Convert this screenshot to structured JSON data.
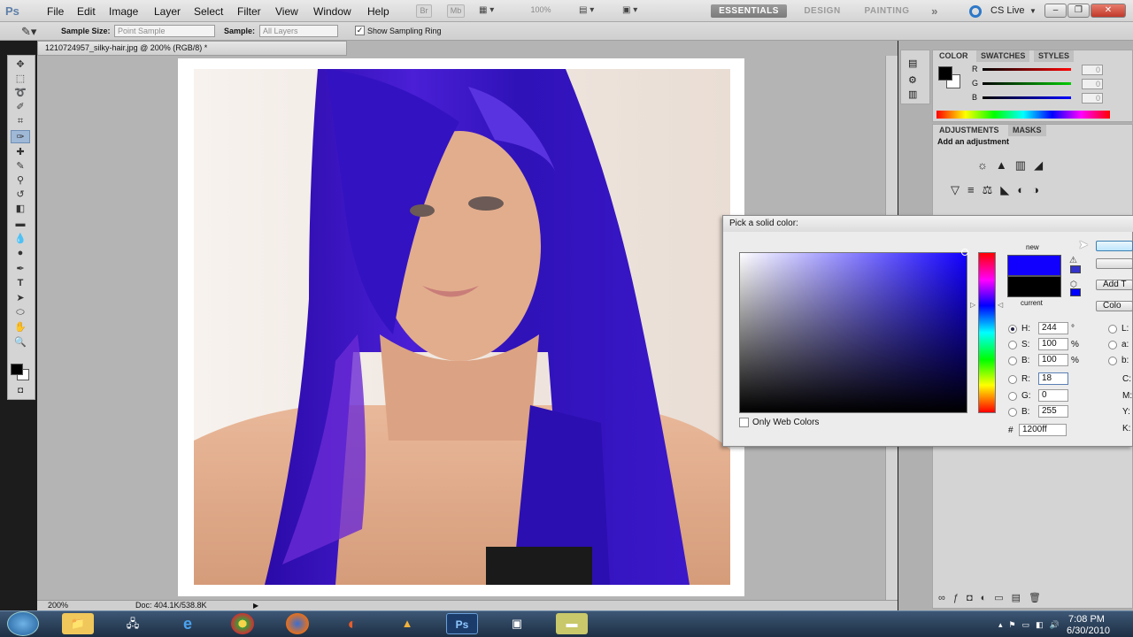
{
  "menubar": {
    "app_logo": "Ps",
    "items": [
      "File",
      "Edit",
      "Image",
      "Layer",
      "Select",
      "Filter",
      "View",
      "Window",
      "Help"
    ],
    "mini_bridge": "Br",
    "mini_mb": "Mb",
    "zoom": "100%",
    "workspaces": [
      "ESSENTIALS",
      "DESIGN",
      "PAINTING"
    ],
    "more": "»",
    "cs_live": "CS Live",
    "win_buttons": [
      "–",
      "❐",
      "✕"
    ]
  },
  "options": {
    "sample_size_label": "Sample Size:",
    "sample_size_value": "Point Sample",
    "sample_label": "Sample:",
    "sample_value": "All Layers",
    "ring_label": "Show Sampling Ring",
    "ring_checked": true
  },
  "document": {
    "tab_title": "1210724957_silky-hair.jpg @ 200% (RGB/8) *",
    "zoom": "200%",
    "doc_info": "Doc: 404.1K/538.8K"
  },
  "color_panel": {
    "tabs": [
      "COLOR",
      "SWATCHES",
      "STYLES"
    ],
    "channels": [
      {
        "label": "R",
        "value": "0"
      },
      {
        "label": "G",
        "value": "0"
      },
      {
        "label": "B",
        "value": "0"
      }
    ]
  },
  "adjustments_panel": {
    "tabs": [
      "ADJUSTMENTS",
      "MASKS"
    ],
    "heading": "Add an adjustment"
  },
  "color_picker": {
    "title": "Pick a solid color:",
    "new_label": "new",
    "current_label": "current",
    "new_color": "#1200ff",
    "current_color": "#000000",
    "hsb": [
      {
        "label": "H:",
        "value": "244",
        "unit": "°",
        "selected": true
      },
      {
        "label": "S:",
        "value": "100",
        "unit": "%",
        "selected": false
      },
      {
        "label": "B:",
        "value": "100",
        "unit": "%",
        "selected": false
      }
    ],
    "rgb": [
      {
        "label": "R:",
        "value": "18",
        "selected": false
      },
      {
        "label": "G:",
        "value": "0",
        "selected": false
      },
      {
        "label": "B:",
        "value": "255",
        "selected": false
      }
    ],
    "lab": [
      {
        "label": "L:"
      },
      {
        "label": "a:"
      },
      {
        "label": "b:"
      }
    ],
    "cmyk": [
      {
        "label": "C:"
      },
      {
        "label": "M:"
      },
      {
        "label": "Y:"
      },
      {
        "label": "K:"
      }
    ],
    "hex_label": "#",
    "hex_value": "1200ff",
    "web_only_label": "Only Web Colors",
    "add_button": "Add T",
    "libraries_button": "Colo"
  },
  "taskbar": {
    "time": "7:08 PM",
    "date": "6/30/2010"
  }
}
